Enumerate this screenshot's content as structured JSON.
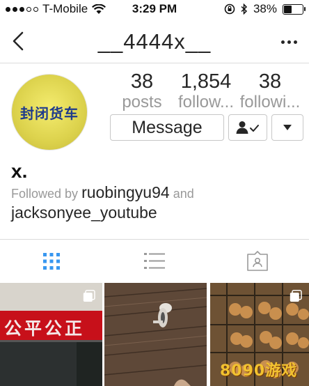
{
  "status_bar": {
    "carrier": "T-Mobile",
    "time": "3:29 PM",
    "battery_percent": "38%",
    "battery_level": 0.38
  },
  "nav": {
    "username": "__4444x__"
  },
  "profile": {
    "avatar_text": "封闭货车",
    "stats": [
      {
        "count": "38",
        "label": "posts"
      },
      {
        "count": "1,854",
        "label": "follow..."
      },
      {
        "count": "38",
        "label": "followi..."
      }
    ],
    "message_button": "Message",
    "display_name": "x.",
    "followed_by_prefix": "Followed by",
    "followed_by_user1": "ruobingyu94",
    "followed_by_and": "and",
    "followed_by_user2": "jacksonyee_youtube"
  },
  "tile_text": {
    "tile1_banner": "公平公正",
    "tile3_watermark": "8090游戏"
  },
  "colors": {
    "text": "#262626",
    "muted": "#999999",
    "accent": "#3897f0",
    "border": "#dbdbdb"
  },
  "icons": [
    "wifi-icon",
    "rotation-lock-icon",
    "bluetooth-icon",
    "battery-icon",
    "back-icon",
    "more-icon",
    "following-icon",
    "dropdown-icon",
    "grid-icon",
    "list-icon",
    "tagged-icon",
    "multiple-photos-icon"
  ]
}
